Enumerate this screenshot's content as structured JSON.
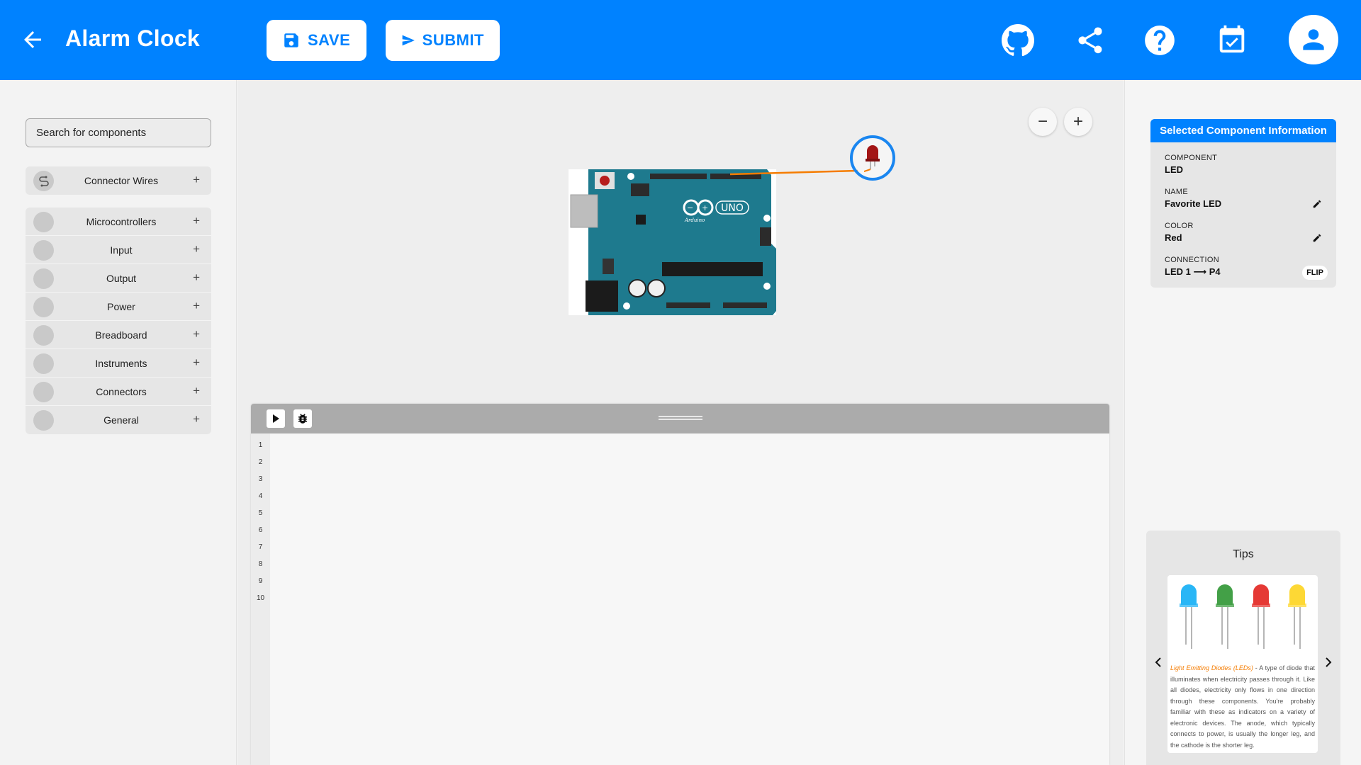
{
  "header": {
    "title": "Alarm Clock",
    "save_label": "SAVE",
    "submit_label": "SUBMIT",
    "icons": [
      "github-icon",
      "share-icon",
      "help-icon",
      "calendar-check-icon",
      "account-icon"
    ],
    "accent_color": "#0082ff"
  },
  "sidebar": {
    "search_placeholder": "Search for components",
    "connector_wires": {
      "label": "Connector Wires",
      "icon": "wire-icon"
    },
    "categories": [
      {
        "label": "Microcontrollers"
      },
      {
        "label": "Input"
      },
      {
        "label": "Output"
      },
      {
        "label": "Power"
      },
      {
        "label": "Breadboard"
      },
      {
        "label": "Instruments"
      },
      {
        "label": "Connectors"
      },
      {
        "label": "General"
      }
    ],
    "expand_symbol": "+"
  },
  "canvas": {
    "zoom_out_symbol": "−",
    "zoom_in_symbol": "+",
    "board_name": "UNO",
    "board_brand": "Arduino"
  },
  "editor": {
    "line_numbers": [
      "1",
      "2",
      "3",
      "4",
      "5",
      "6",
      "7",
      "8",
      "9",
      "10"
    ]
  },
  "info_panel": {
    "title": "Selected Component Information",
    "component_label": "COMPONENT",
    "component_value": "LED",
    "name_label": "NAME",
    "name_value": "Favorite LED",
    "color_label": "COLOR",
    "color_value": "Red",
    "connection_label": "CONNECTION",
    "connection_value": "LED 1 ⟶ P4",
    "flip_label": "FLIP"
  },
  "tips": {
    "title": "Tips",
    "highlight": "Light Emitting Diodes (LEDs)",
    "body": " - A type of diode that illuminates when electricity passes through it. Like all diodes, electricity only flows in one direction through these components. You're probably familiar with these as indicators on a variety of electronic devices. The anode, which typically connects to power, is usually the longer leg, and the cathode is the shorter leg.",
    "led_colors": [
      "#29b6f6",
      "#43a047",
      "#e53935",
      "#fdd835"
    ]
  }
}
